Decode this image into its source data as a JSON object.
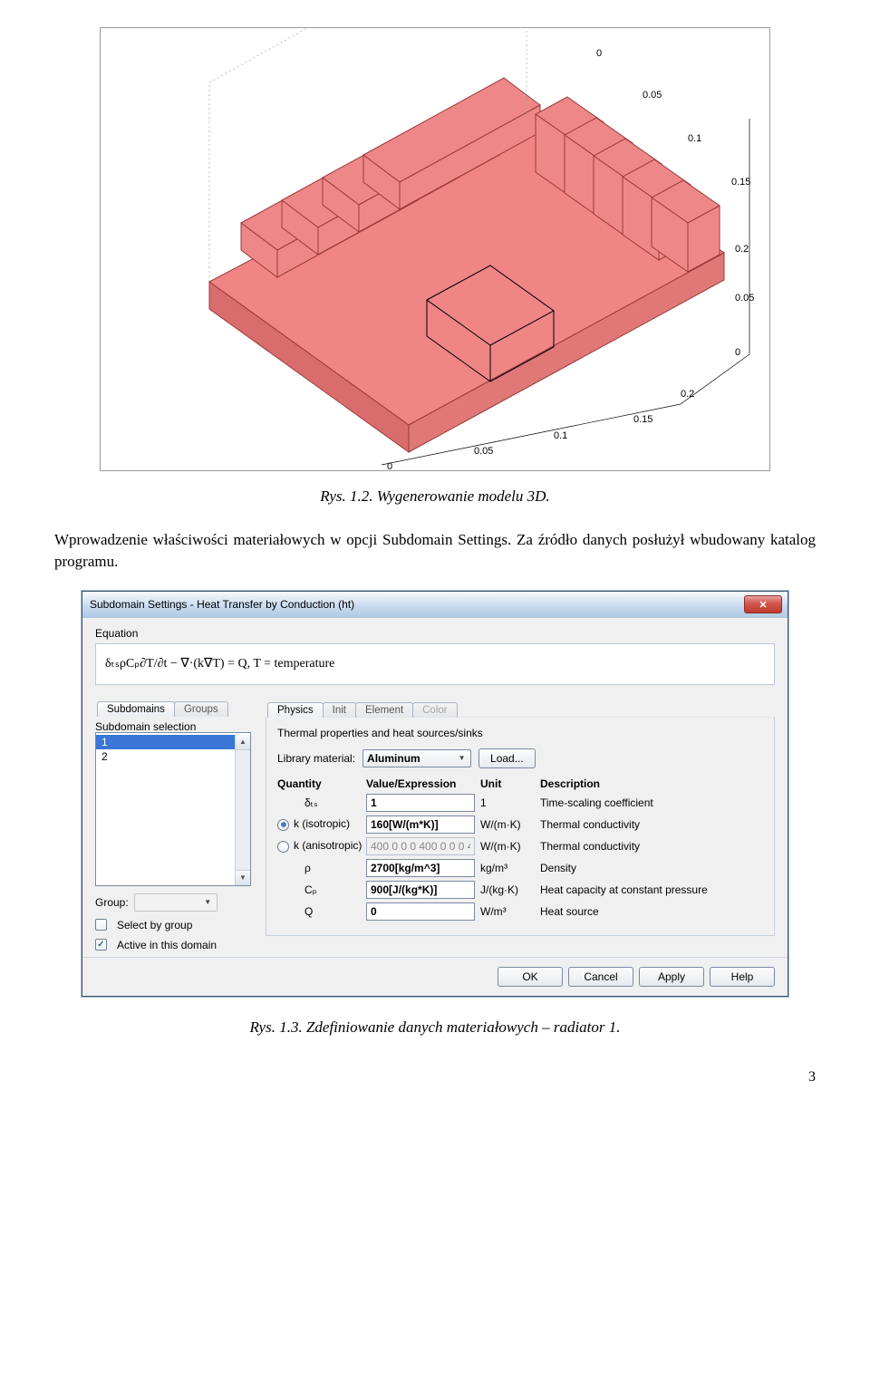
{
  "figure3d": {
    "axis_bottom": [
      "0",
      "0.05",
      "0.1",
      "0.15"
    ],
    "axis_right_outer": [
      "0",
      "0.05",
      "0.1",
      "0.15",
      "0.2"
    ],
    "axis_right_inner": [
      "0",
      "0.05",
      "0.2"
    ]
  },
  "caption_fig12": "Rys. 1.2. Wygenerowanie modelu 3D.",
  "body_text": "Wprowadzenie właściwości materiałowych w opcji Subdomain Settings. Za źródło danych posłużył wbudowany katalog programu.",
  "dialog": {
    "title": "Subdomain Settings - Heat Transfer by Conduction (ht)",
    "equation_label": "Equation",
    "equation": "δₜₛρCₚ∂T/∂t − ∇·(k∇T) = Q, T = temperature",
    "left": {
      "tabs": [
        "Subdomains",
        "Groups"
      ],
      "selection_label": "Subdomain selection",
      "items": [
        "1",
        "2"
      ],
      "selected_index": 0,
      "group_label": "Group:",
      "select_by_group_label": "Select by group",
      "select_by_group_checked": false,
      "active_label": "Active in this domain",
      "active_checked": true
    },
    "right": {
      "tabs": [
        {
          "label": "Physics",
          "active": true,
          "disabled": false
        },
        {
          "label": "Init",
          "active": false,
          "disabled": false
        },
        {
          "label": "Element",
          "active": false,
          "disabled": false
        },
        {
          "label": "Color",
          "active": false,
          "disabled": true
        }
      ],
      "hint": "Thermal properties and heat sources/sinks",
      "library_label": "Library material:",
      "library_value": "Aluminum",
      "load_label": "Load...",
      "headers": {
        "qty": "Quantity",
        "val": "Value/Expression",
        "unit": "Unit",
        "desc": "Description"
      },
      "rows": [
        {
          "label": "δₜₛ",
          "value": "1",
          "unit": "1",
          "desc": "Time-scaling coefficient",
          "disabled": false,
          "radio": null
        },
        {
          "label": "k (isotropic)",
          "value": "160[W/(m*K)]",
          "unit": "W/(m·K)",
          "desc": "Thermal conductivity",
          "disabled": false,
          "radio": true
        },
        {
          "label": "k (anisotropic)",
          "value": "400 0 0 0 400 0 0 0 4",
          "unit": "W/(m·K)",
          "desc": "Thermal conductivity",
          "disabled": true,
          "radio": false
        },
        {
          "label": "ρ",
          "value": "2700[kg/m^3]",
          "unit": "kg/m³",
          "desc": "Density",
          "disabled": false,
          "radio": null
        },
        {
          "label": "Cₚ",
          "value": "900[J/(kg*K)]",
          "unit": "J/(kg·K)",
          "desc": "Heat capacity at constant pressure",
          "disabled": false,
          "radio": null
        },
        {
          "label": "Q",
          "value": "0",
          "unit": "W/m³",
          "desc": "Heat source",
          "disabled": false,
          "radio": null
        }
      ]
    },
    "buttons": {
      "ok": "OK",
      "cancel": "Cancel",
      "apply": "Apply",
      "help": "Help"
    }
  },
  "caption_fig13": "Rys. 1.3. Zdefiniowanie danych materiałowych – radiator 1.",
  "page_number": "3"
}
